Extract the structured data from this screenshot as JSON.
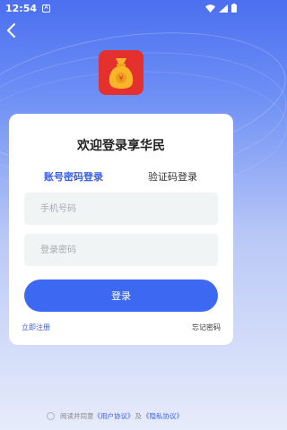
{
  "status_bar": {
    "time": "12:54",
    "notification_icon_label": "A"
  },
  "header": {
    "app_logo_icon": "money-bag-icon",
    "back_icon": "back-arrow-icon"
  },
  "login_card": {
    "title": "欢迎登录享华民",
    "tabs": [
      {
        "label": "账号密码登录",
        "active": true
      },
      {
        "label": "验证码登录",
        "active": false
      }
    ],
    "phone_placeholder": "手机号码",
    "password_placeholder": "登录密码",
    "login_button": "登录",
    "register_link": "立即注册",
    "forgot_link": "忘记密码"
  },
  "agreement": {
    "prefix": "阅读并同意",
    "user_agreement": "《用户协议》",
    "and": "及",
    "privacy_policy": "《隐私协议》"
  },
  "colors": {
    "accent": "#3d68f2",
    "logo_bg": "#e5312d"
  }
}
